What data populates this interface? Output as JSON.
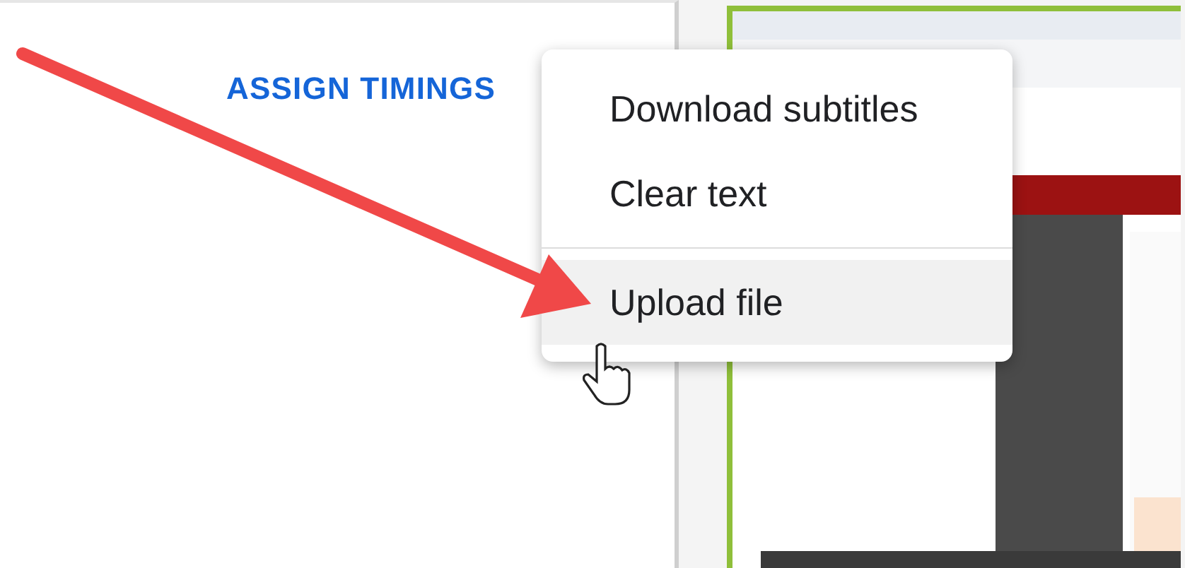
{
  "assign_timings_button": {
    "label": "ASSIGN TIMINGS"
  },
  "menu": {
    "items": [
      {
        "label": "Download subtitles",
        "selected": false,
        "divider_before": false
      },
      {
        "label": "Clear text",
        "selected": false,
        "divider_before": false
      },
      {
        "label": "Upload file",
        "selected": true,
        "divider_before": true
      }
    ]
  }
}
